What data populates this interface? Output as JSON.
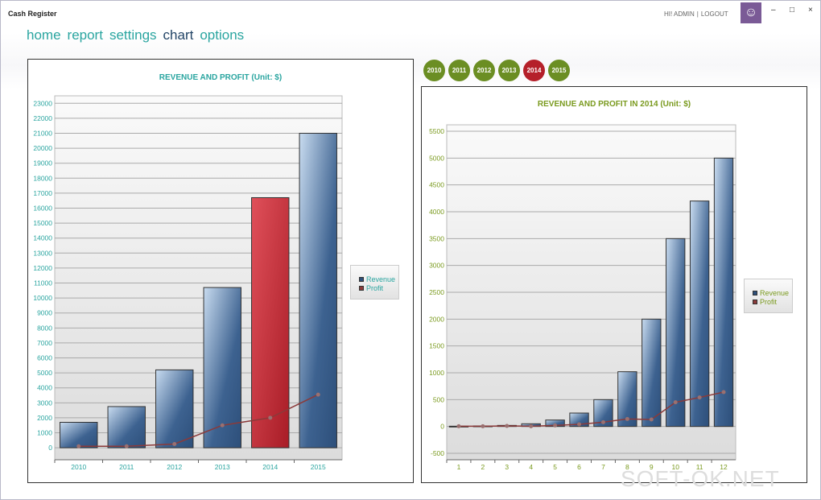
{
  "window": {
    "title": "Cash Register",
    "greeting": "HI! ADMIN",
    "logout": "LOGOUT",
    "logo_icon": "smiley-icon"
  },
  "nav": [
    {
      "label": "home"
    },
    {
      "label": "report"
    },
    {
      "label": "settings"
    },
    {
      "label": "chart",
      "active": true
    },
    {
      "label": "options"
    }
  ],
  "year_buttons": [
    {
      "label": "2010"
    },
    {
      "label": "2011"
    },
    {
      "label": "2012"
    },
    {
      "label": "2013"
    },
    {
      "label": "2014",
      "selected": true
    },
    {
      "label": "2015"
    }
  ],
  "colors": {
    "teal": "#2aa5a0",
    "olive": "#7a9a1e",
    "selected": "#b5202a",
    "revenue": "#2d4f7a",
    "profit": "#8b3a3a"
  },
  "watermark": "SOFT-OK.NET",
  "chart_data": [
    {
      "type": "bar",
      "title": "REVENUE AND PROFIT (Unit: $)",
      "categories": [
        "2010",
        "2011",
        "2012",
        "2013",
        "2014",
        "2015"
      ],
      "ylim": [
        -800,
        23500
      ],
      "yticks": [
        0,
        1000,
        2000,
        3000,
        4000,
        5000,
        6000,
        7000,
        8000,
        9000,
        10000,
        11000,
        12000,
        13000,
        14000,
        15000,
        16000,
        17000,
        18000,
        19000,
        20000,
        21000,
        22000,
        23000
      ],
      "highlight": "2014",
      "legend": "right",
      "grid": true,
      "series": [
        {
          "name": "Revenue",
          "type": "bar",
          "values": [
            1700,
            2750,
            5200,
            10700,
            16700,
            21000
          ]
        },
        {
          "name": "Profit",
          "type": "line",
          "values": [
            100,
            100,
            250,
            1500,
            2000,
            3550
          ]
        }
      ]
    },
    {
      "type": "bar",
      "title": "REVENUE AND PROFIT IN 2014 (Unit: $)",
      "categories": [
        "1",
        "2",
        "3",
        "4",
        "5",
        "6",
        "7",
        "8",
        "9",
        "10",
        "11",
        "12"
      ],
      "ylim": [
        -620,
        5620
      ],
      "yticks": [
        -500,
        0,
        500,
        1000,
        1500,
        2000,
        2500,
        3000,
        3500,
        4000,
        4500,
        5000,
        5500
      ],
      "legend": "right",
      "grid": true,
      "series": [
        {
          "name": "Revenue",
          "type": "bar",
          "values": [
            5,
            10,
            20,
            50,
            120,
            250,
            500,
            1020,
            2000,
            3500,
            4200,
            5000
          ]
        },
        {
          "name": "Profit",
          "type": "line",
          "values": [
            5,
            5,
            10,
            5,
            20,
            40,
            80,
            140,
            130,
            450,
            540,
            640
          ]
        }
      ]
    }
  ]
}
